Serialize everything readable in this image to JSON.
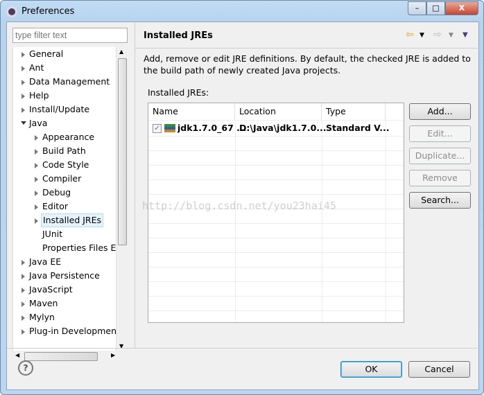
{
  "window": {
    "title": "Preferences",
    "min": "–",
    "max": "□",
    "close": "X"
  },
  "sidebar": {
    "filter_placeholder": "type filter text",
    "items": [
      {
        "label": "General",
        "level": 0,
        "state": "closed"
      },
      {
        "label": "Ant",
        "level": 0,
        "state": "closed"
      },
      {
        "label": "Data Management",
        "level": 0,
        "state": "closed"
      },
      {
        "label": "Help",
        "level": 0,
        "state": "closed"
      },
      {
        "label": "Install/Update",
        "level": 0,
        "state": "closed"
      },
      {
        "label": "Java",
        "level": 0,
        "state": "open"
      },
      {
        "label": "Appearance",
        "level": 1,
        "state": "closed"
      },
      {
        "label": "Build Path",
        "level": 1,
        "state": "closed"
      },
      {
        "label": "Code Style",
        "level": 1,
        "state": "closed"
      },
      {
        "label": "Compiler",
        "level": 1,
        "state": "closed"
      },
      {
        "label": "Debug",
        "level": 1,
        "state": "closed"
      },
      {
        "label": "Editor",
        "level": 1,
        "state": "closed"
      },
      {
        "label": "Installed JREs",
        "level": 1,
        "state": "closed",
        "selected": true
      },
      {
        "label": "JUnit",
        "level": 1,
        "state": "leaf"
      },
      {
        "label": "Properties Files Ed",
        "level": 1,
        "state": "leaf"
      },
      {
        "label": "Java EE",
        "level": 0,
        "state": "closed"
      },
      {
        "label": "Java Persistence",
        "level": 0,
        "state": "closed"
      },
      {
        "label": "JavaScript",
        "level": 0,
        "state": "closed"
      },
      {
        "label": "Maven",
        "level": 0,
        "state": "closed"
      },
      {
        "label": "Mylyn",
        "level": 0,
        "state": "closed"
      },
      {
        "label": "Plug-in Development",
        "level": 0,
        "state": "closed"
      }
    ]
  },
  "page": {
    "title": "Installed JREs",
    "description": "Add, remove or edit JRE definitions. By default, the checked JRE is added to the build path of newly created Java projects.",
    "table_label": "Installed JREs:",
    "columns": [
      "Name",
      "Location",
      "Type"
    ],
    "rows": [
      {
        "checked": true,
        "name": "jdk1.7.0_67 ...",
        "location": "D:\\Java\\jdk1.7.0...",
        "type": "Standard V..."
      }
    ],
    "buttons": {
      "add": "Add...",
      "edit": "Edit...",
      "duplicate": "Duplicate...",
      "remove": "Remove",
      "search": "Search..."
    }
  },
  "watermark": "http://blog.csdn.net/you23hai45",
  "footer": {
    "help": "?",
    "ok": "OK",
    "cancel": "Cancel"
  }
}
